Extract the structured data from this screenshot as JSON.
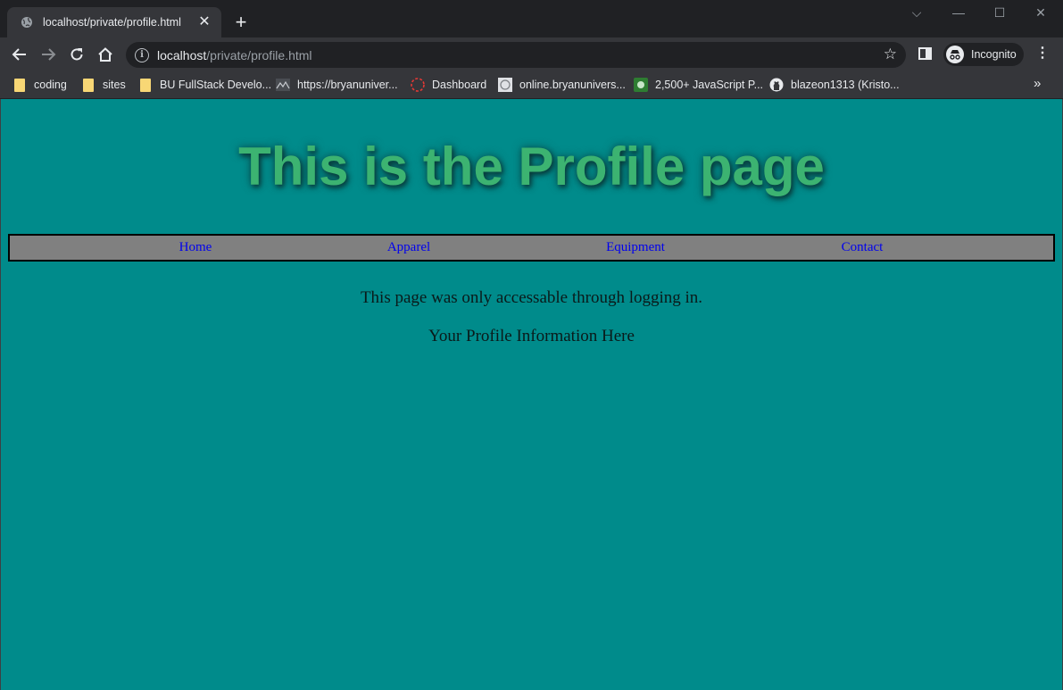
{
  "browser": {
    "tab_title": "localhost/private/profile.html",
    "url_host": "localhost",
    "url_path": "/private/profile.html",
    "incognito_label": "Incognito",
    "bookmarks": [
      {
        "label": "coding",
        "icon": "folder-icon"
      },
      {
        "label": "sites",
        "icon": "folder-icon"
      },
      {
        "label": "BU FullStack Develo...",
        "icon": "folder-icon"
      },
      {
        "label": "https://bryanuniver...",
        "icon": "site-favicon"
      },
      {
        "label": "Dashboard",
        "icon": "dashboard-favicon"
      },
      {
        "label": "online.bryanunivers...",
        "icon": "site-favicon"
      },
      {
        "label": "2,500+ JavaScript P...",
        "icon": "site-favicon"
      },
      {
        "label": "blazeon1313 (Kristo...",
        "icon": "github-icon"
      }
    ],
    "overflow_label": "»"
  },
  "page": {
    "background": "#008b8b",
    "title": "This is the Profile page",
    "title_color": "#3cb371",
    "nav": {
      "background": "#808080",
      "links": [
        "Home",
        "Apparel",
        "Equipment",
        "Contact"
      ],
      "link_color": "#0000ee"
    },
    "message": "This page was only accessable through logging in.",
    "profile_info": "Your Profile Information Here"
  }
}
